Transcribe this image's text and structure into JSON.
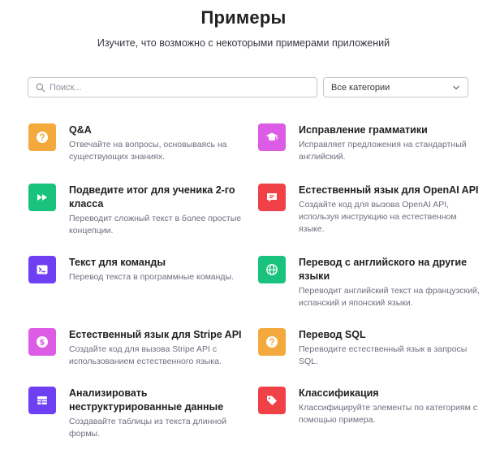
{
  "header": {
    "title": "Примеры",
    "subtitle": "Изучите, что возможно с некоторыми примерами приложений"
  },
  "search": {
    "placeholder": "Поиск..."
  },
  "category_filter": {
    "selected": "Все категории"
  },
  "colors": {
    "orange": "#f4a93d",
    "magenta": "#dd5ce5",
    "green": "#19c37d",
    "red": "#ef4146",
    "purple": "#6e3ff3"
  },
  "examples": [
    {
      "title": "Q&A",
      "desc1": "Отвечайте на вопросы, основываясь на",
      "desc2": "существующих знаниях.",
      "icon": "question-icon"
    },
    {
      "title": "Исправление грамматики",
      "desc1": "Исправляет предложения на стандартный",
      "desc2": "английский.",
      "icon": "graduation-cap-icon"
    },
    {
      "title1": "Подведите итог для ученика 2-го",
      "title2": "класса",
      "desc1": "Переводит сложный текст в более простые",
      "desc2": "концепции.",
      "icon": "fast-forward-icon"
    },
    {
      "title": "Естественный язык для OpenAI API",
      "desc1": "Создайте код для вызова OpenAI API,",
      "desc2": "используя инструкцию на естественном",
      "desc3": "языке.",
      "icon": "message-icon"
    },
    {
      "title": "Текст для команды",
      "desc1": "Перевод текста в программные команды.",
      "icon": "terminal-icon"
    },
    {
      "title1": "Перевод с английского на другие",
      "title2": "языки",
      "desc1": "Переводит английский текст на французский,",
      "desc2": "испанский и японский языки.",
      "icon": "globe-icon"
    },
    {
      "title": "Естественный язык для Stripe API",
      "desc1": "Создайте код для вызова Stripe API с",
      "desc2": "использованием естественного языка.",
      "icon": "dollar-icon"
    },
    {
      "title": "Перевод SQL",
      "desc1": "Переводите естественный язык в запросы",
      "desc2": "SQL.",
      "icon": "question-icon"
    },
    {
      "title1": "Анализировать",
      "title2": "неструктурированные данные",
      "desc1": "Создавайте таблицы из текста длинной",
      "desc2": "формы.",
      "icon": "table-icon"
    },
    {
      "title": "Классификация",
      "desc1": "Классифицируйте элементы по категориям с",
      "desc2": "помощью примера.",
      "icon": "tag-icon"
    }
  ]
}
